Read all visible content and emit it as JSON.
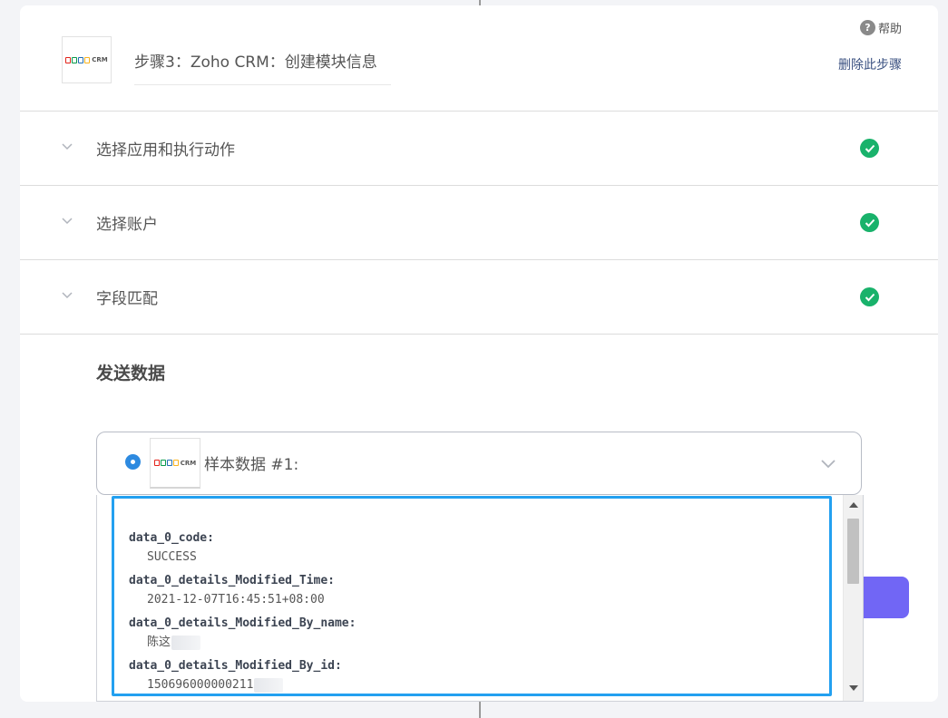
{
  "header": {
    "step_title": "步骤3：Zoho CRM：创建模块信息",
    "help_label": "帮助",
    "help_icon": "question-icon",
    "delete_label": "删除此步骤",
    "logo_text": "CRM"
  },
  "sections": [
    {
      "label": "选择应用和执行动作",
      "status": "complete"
    },
    {
      "label": "选择账户",
      "status": "complete"
    },
    {
      "label": "字段匹配",
      "status": "complete"
    }
  ],
  "send": {
    "title": "发送数据",
    "sample_label": "样本数据 #1:",
    "fields": [
      {
        "key": "data_0_code:",
        "value": "SUCCESS"
      },
      {
        "key": "data_0_details_Modified_Time:",
        "value": "2021-12-07T16:45:51+08:00"
      },
      {
        "key": "data_0_details_Modified_By_name:",
        "value": "陈这"
      },
      {
        "key": "data_0_details_Modified_By_id:",
        "value": "150696000000211"
      }
    ]
  },
  "colors": {
    "accent_blue": "#23a0f0",
    "success_green": "#19b26b",
    "purple_button": "#7166f5",
    "radio_blue": "#2d8ae0"
  }
}
